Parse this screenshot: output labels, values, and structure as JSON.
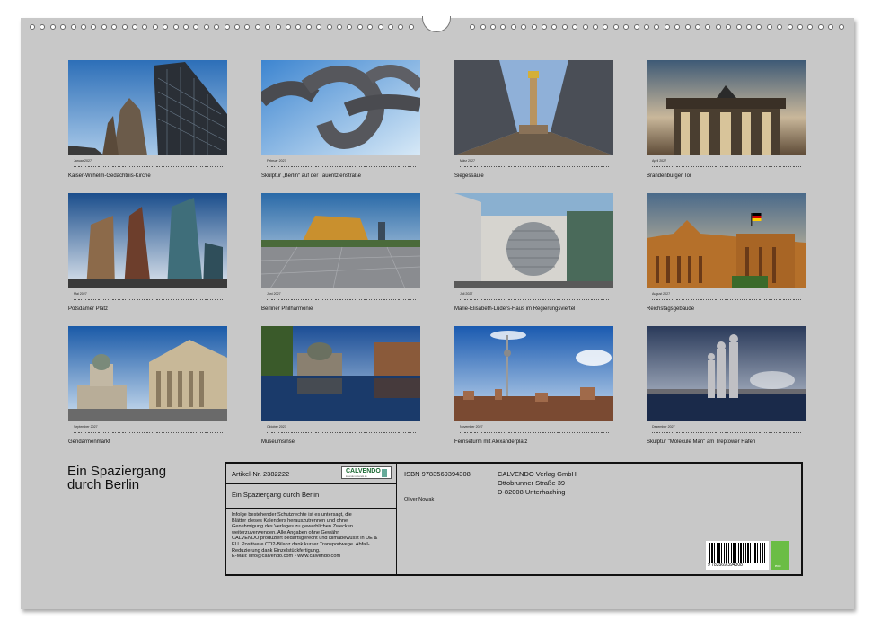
{
  "calendar": {
    "title_line1": "Ein Spaziergang",
    "title_line2": "durch Berlin"
  },
  "months": [
    {
      "month": "Januar 2027",
      "caption": "Kaiser-Wilhelm-Gedächtnis-Kirche"
    },
    {
      "month": "Februar 2027",
      "caption": "Skulptur „Berlin“ auf der Tauentzienstraße"
    },
    {
      "month": "März 2027",
      "caption": "Siegessäule"
    },
    {
      "month": "April 2027",
      "caption": "Brandenburger Tor"
    },
    {
      "month": "Mai 2027",
      "caption": "Potsdamer Platz"
    },
    {
      "month": "Juni 2027",
      "caption": "Berliner Philharmonie"
    },
    {
      "month": "Juli 2027",
      "caption": "Marie-Elisabeth-Lüders-Haus im Regierungsviertel"
    },
    {
      "month": "August 2027",
      "caption": "Reichstagsgebäude"
    },
    {
      "month": "September 2027",
      "caption": "Gendarmenmarkt"
    },
    {
      "month": "Oktober 2027",
      "caption": "Museumsinsel"
    },
    {
      "month": "November 2027",
      "caption": "Fernseturm mit Alexanderplatz"
    },
    {
      "month": "Dezember 2027",
      "caption": "Skulptur \"Molecule Man\" am Treptower Hafen"
    }
  ],
  "info": {
    "article": "Artikel-Nr. 2382222",
    "logo": "CALVENDO",
    "logo_sub": "kalender.calvendo.de",
    "book_title": "Ein Spaziergang durch Berlin",
    "legal_lines": [
      "Infolge bestehender Schutzrechte ist es untersagt, die",
      "Blätter dieses Kalenders herauszutrennen und ohne",
      "Genehmigung des Verlages zu gewerblichen Zwecken",
      "weiterzuverwenden. Alle Angaben ohne Gewähr.",
      "CALVENDO produziert bedarfsgerecht und klimabewusst in DE &",
      "EU. Positivere CO2-Bilanz dank kurzer Transportwege. Abfall-",
      "Reduzierung dank Einzelstückfertigung.",
      "E-Mail: info@calvendo.com • www.calvendo.com"
    ],
    "isbn": "ISBN 9783569394308",
    "author": "Oliver Nowak",
    "publisher_lines": [
      "CALVENDO Verlag GmbH",
      "Ottobrunner Straße 39",
      "D-82008 Unterhaching"
    ],
    "barcode_number": "9 783569 394308",
    "eco_label": "eco"
  }
}
